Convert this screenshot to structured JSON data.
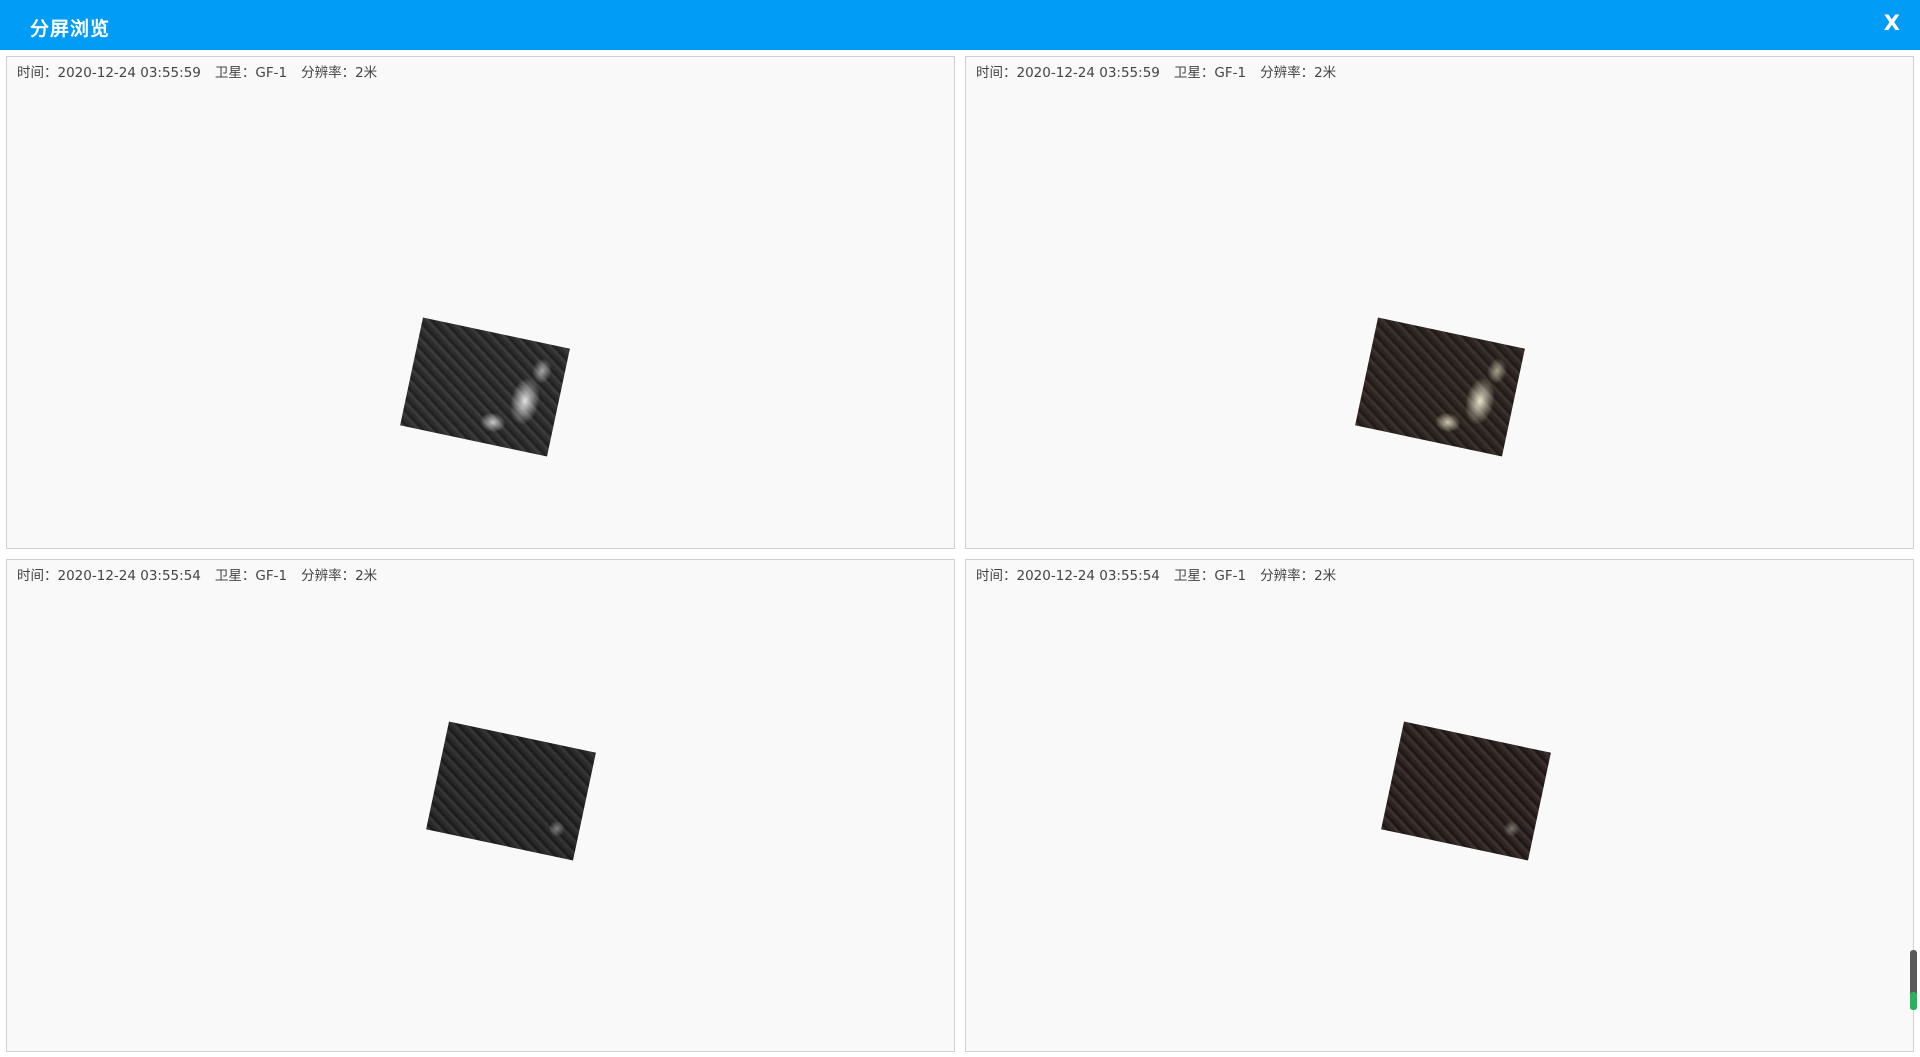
{
  "window": {
    "title": "分屏浏览",
    "close_label": "X"
  },
  "panes": [
    {
      "time": "时间：2020-12-24 03:55:59",
      "satellite": "卫星：GF-1",
      "resolution": "分辨率：2米",
      "imagery": "grayscale"
    },
    {
      "time": "时间：2020-12-24 03:55:59",
      "satellite": "卫星：GF-1",
      "resolution": "分辨率：2米",
      "imagery": "true-color"
    },
    {
      "time": "时间：2020-12-24 03:55:54",
      "satellite": "卫星：GF-1",
      "resolution": "分辨率：2米",
      "imagery": "grayscale"
    },
    {
      "time": "时间：2020-12-24 03:55:54",
      "satellite": "卫星：GF-1",
      "resolution": "分辨率：2米",
      "imagery": "true-color"
    }
  ],
  "colors": {
    "titlebar": "#009cf5",
    "pane_background": "#f9f9f9",
    "scroll_thumb": "#27b35a"
  }
}
